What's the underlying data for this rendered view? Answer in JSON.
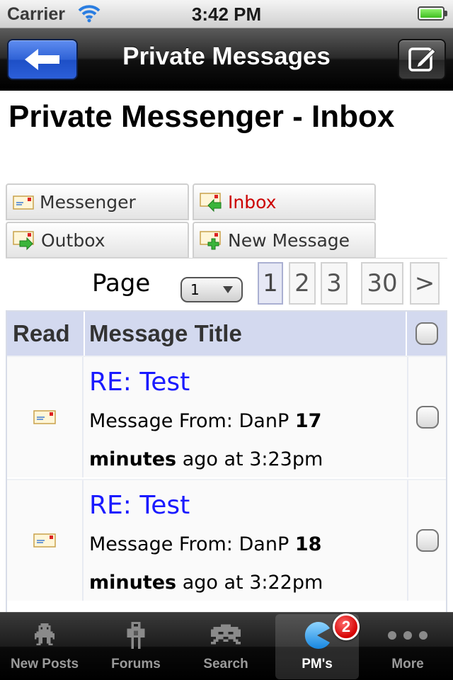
{
  "status_bar": {
    "carrier": "Carrier",
    "time": "3:42 PM"
  },
  "nav_bar": {
    "title": "Private Messages"
  },
  "page_heading": "Private Messenger - Inbox",
  "tabs": [
    {
      "label": "Messenger",
      "icon": "envelope-icon",
      "active": false
    },
    {
      "label": "Inbox",
      "icon": "inbox-arrow-icon",
      "active": true
    },
    {
      "label": "Outbox",
      "icon": "outbox-arrow-icon",
      "active": false
    },
    {
      "label": "New Message",
      "icon": "new-message-plus-icon",
      "active": false
    }
  ],
  "pagination": {
    "label": "Page",
    "selected": "1",
    "buttons": [
      "1",
      "2",
      "3",
      "30",
      ">"
    ],
    "current": "1"
  },
  "table": {
    "headers": {
      "read": "Read",
      "title": "Message Title"
    },
    "rows": [
      {
        "title": "RE: Test",
        "from_prefix": "Message From: DanP",
        "age_bold": "17 minutes",
        "age_suffix": "ago at 3:23pm"
      },
      {
        "title": "RE: Test",
        "from_prefix": "Message From: DanP",
        "age_bold": "18 minutes",
        "age_suffix": "ago at 3:22pm"
      }
    ]
  },
  "tab_bar": {
    "items": [
      {
        "label": "New Posts",
        "icon": "alien-sprite-icon"
      },
      {
        "label": "Forums",
        "icon": "robot-sprite-icon"
      },
      {
        "label": "Search",
        "icon": "space-invader-icon"
      },
      {
        "label": "PM's",
        "icon": "pacman-icon",
        "selected": true
      },
      {
        "label": "More",
        "icon": "more-dots-icon"
      }
    ],
    "badge": "2"
  },
  "colors": {
    "link_blue": "#1a1aff",
    "active_tab_red": "#cc0000",
    "header_row": "#d3d9ef",
    "back_button_blue": "#2f62d6",
    "badge_red": "#d40000"
  }
}
